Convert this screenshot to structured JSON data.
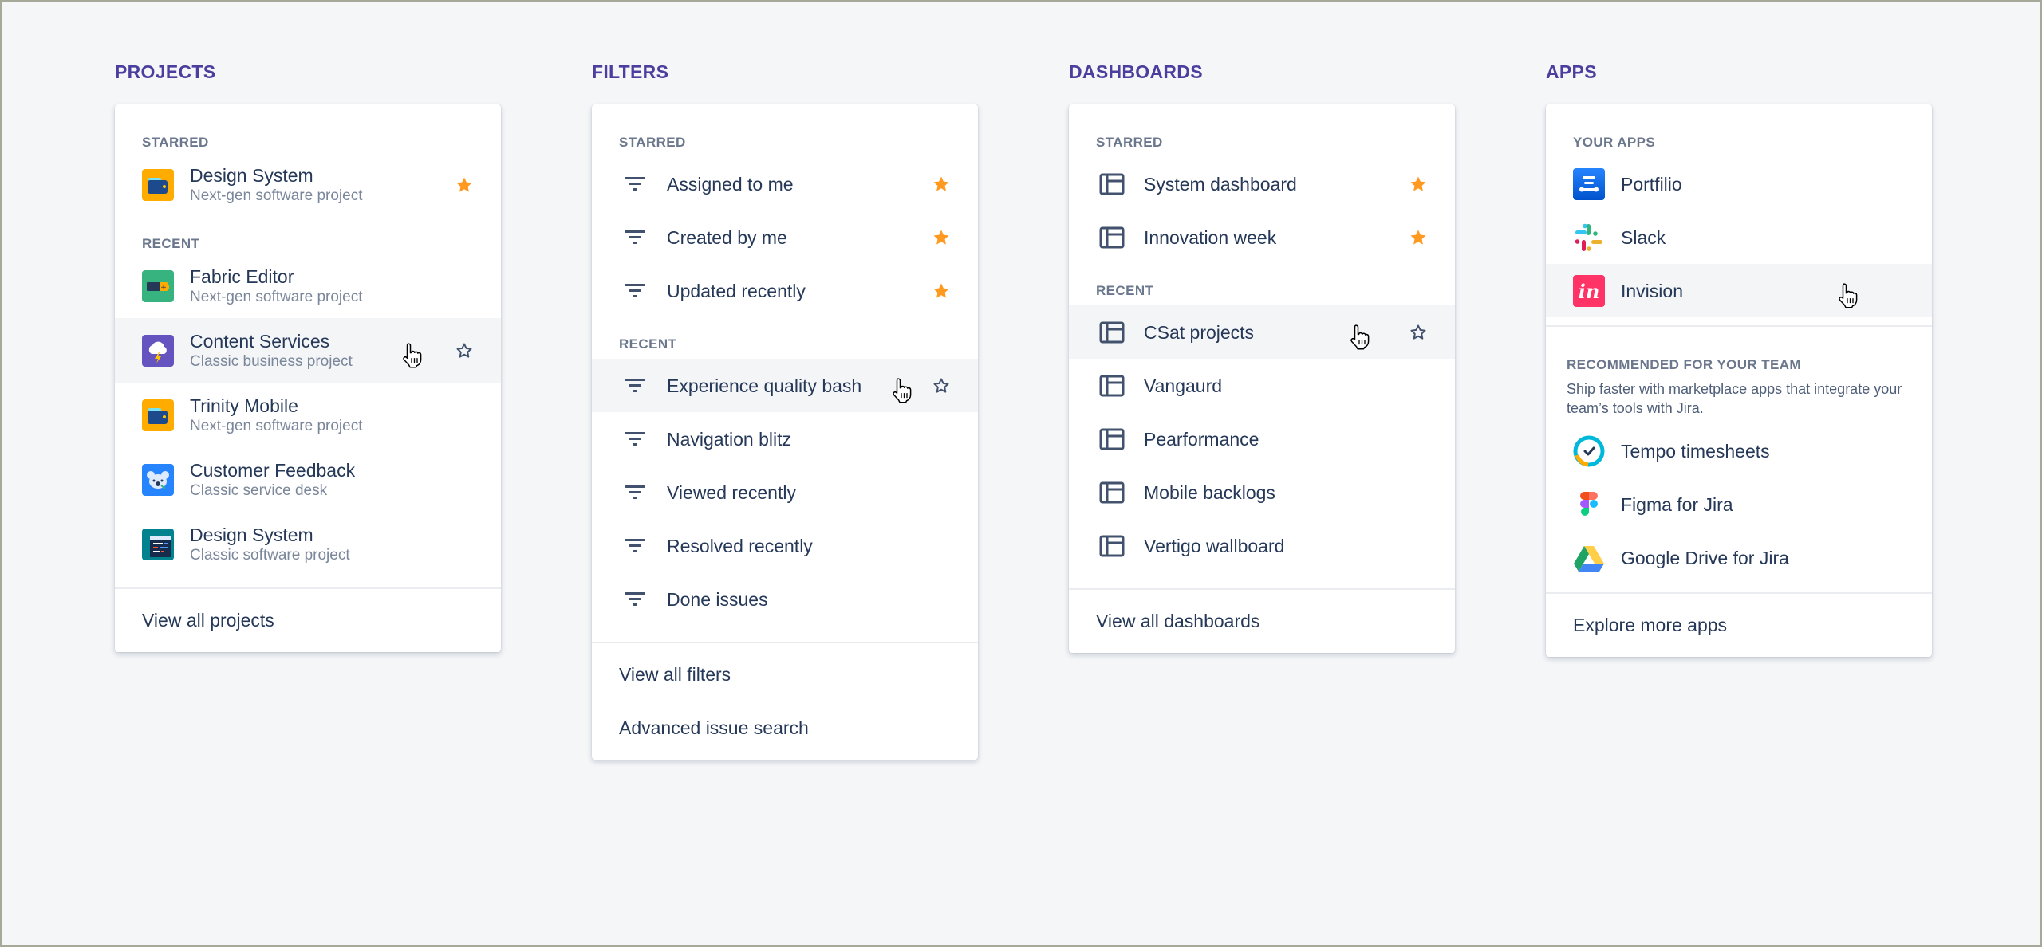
{
  "colors": {
    "heading": "#4a3f9e",
    "star_filled": "#ff991f",
    "icon": "#42526e",
    "background": "#f4f6f8"
  },
  "projects": {
    "title": "PROJECTS",
    "starred_label": "STARRED",
    "recent_label": "RECENT",
    "starred": [
      {
        "name": "Design System",
        "subtitle": "Next-gen software project",
        "icon": "wallet-orange-icon",
        "starred": true
      }
    ],
    "recent": [
      {
        "name": "Fabric Editor",
        "subtitle": "Next-gen software project",
        "icon": "battery-green-icon"
      },
      {
        "name": "Content Services",
        "subtitle": "Classic business project",
        "icon": "cloud-lightning-purple-icon",
        "hovered": true
      },
      {
        "name": "Trinity Mobile",
        "subtitle": "Next-gen software project",
        "icon": "wallet-orange-icon"
      },
      {
        "name": "Customer Feedback",
        "subtitle": "Classic service desk",
        "icon": "koala-blue-icon"
      },
      {
        "name": "Design System",
        "subtitle": "Classic software project",
        "icon": "code-window-teal-icon"
      }
    ],
    "footer": "View all projects"
  },
  "filters": {
    "title": "FILTERS",
    "starred_label": "STARRED",
    "recent_label": "RECENT",
    "starred": [
      {
        "name": "Assigned to me",
        "starred": true
      },
      {
        "name": "Created by me",
        "starred": true
      },
      {
        "name": "Updated recently",
        "starred": true
      }
    ],
    "recent": [
      {
        "name": "Experience quality bash",
        "hovered": true
      },
      {
        "name": "Navigation blitz"
      },
      {
        "name": "Viewed recently"
      },
      {
        "name": "Resolved recently"
      },
      {
        "name": "Done issues"
      }
    ],
    "footer": [
      "View all filters",
      "Advanced issue search"
    ]
  },
  "dashboards": {
    "title": "DASHBOARDS",
    "starred_label": "STARRED",
    "recent_label": "RECENT",
    "starred": [
      {
        "name": "System dashboard",
        "starred": true
      },
      {
        "name": "Innovation week",
        "starred": true
      }
    ],
    "recent": [
      {
        "name": "CSat projects",
        "hovered": true
      },
      {
        "name": "Vangaurd"
      },
      {
        "name": "Pearformance"
      },
      {
        "name": "Mobile backlogs"
      },
      {
        "name": "Vertigo wallboard"
      }
    ],
    "footer": "View all dashboards"
  },
  "apps": {
    "title": "APPS",
    "your_apps_label": "YOUR APPS",
    "your_apps": [
      {
        "name": "Portfilio",
        "icon": "portfolio-icon"
      },
      {
        "name": "Slack",
        "icon": "slack-icon"
      },
      {
        "name": "Invision",
        "icon": "invision-icon",
        "hovered": true
      }
    ],
    "recommended_label": "RECOMMENDED FOR YOUR TEAM",
    "recommended_desc": "Ship faster with marketplace apps that integrate your team’s tools with Jira.",
    "recommended": [
      {
        "name": "Tempo timesheets",
        "icon": "tempo-icon"
      },
      {
        "name": "Figma for Jira",
        "icon": "figma-icon"
      },
      {
        "name": "Google Drive for Jira",
        "icon": "google-drive-icon"
      }
    ],
    "footer": "Explore more apps"
  }
}
